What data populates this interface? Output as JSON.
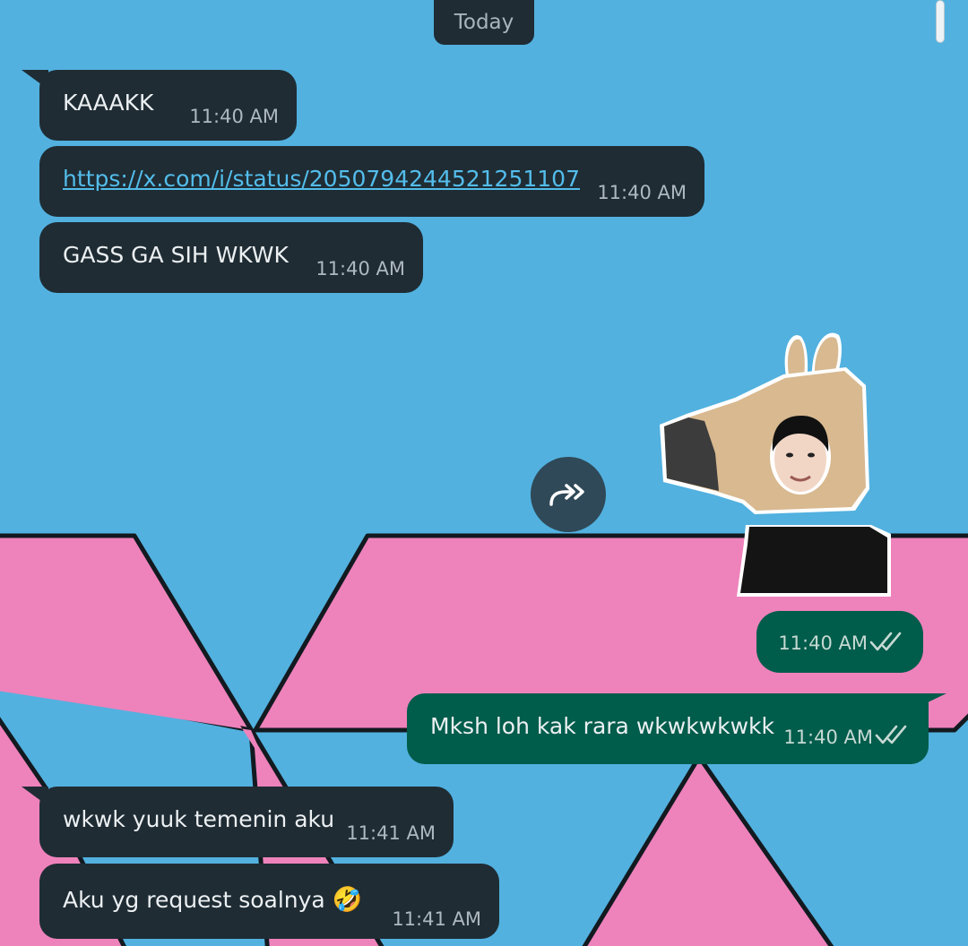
{
  "chat": {
    "date_chip": "Today",
    "messages": [
      {
        "dir": "in",
        "text": "KAAAKK",
        "time": "11:40 AM"
      },
      {
        "dir": "in",
        "text": "https://x.com/i/status/2050794244521251107",
        "time": "11:40 AM",
        "is_link": true
      },
      {
        "dir": "in",
        "text": "GASS GA SIH WKWK",
        "time": "11:40 AM"
      },
      {
        "dir": "out",
        "type": "sticker",
        "sticker_icon": "horse-head-costume-sticker",
        "time": "11:40 AM",
        "status": "read"
      },
      {
        "dir": "out",
        "text": "Mksh loh kak rara wkwkwkwkk",
        "time": "11:40 AM",
        "status": "read"
      },
      {
        "dir": "in",
        "text": "wkwk yuuk temenin aku",
        "time": "11:41 AM"
      },
      {
        "dir": "in",
        "text": "Aku yg request soalnya",
        "emoji": "🤣",
        "time": "11:41 AM"
      }
    ]
  },
  "icons": {
    "forward": "forward-icon",
    "read_receipt": "double-check-icon"
  },
  "colors": {
    "wallpaper_blue": "#52b1df",
    "wallpaper_pink": "#ee82bb",
    "incoming_bubble": "#1f2c34",
    "outgoing_bubble": "#005c4b",
    "link": "#53bdeb"
  }
}
